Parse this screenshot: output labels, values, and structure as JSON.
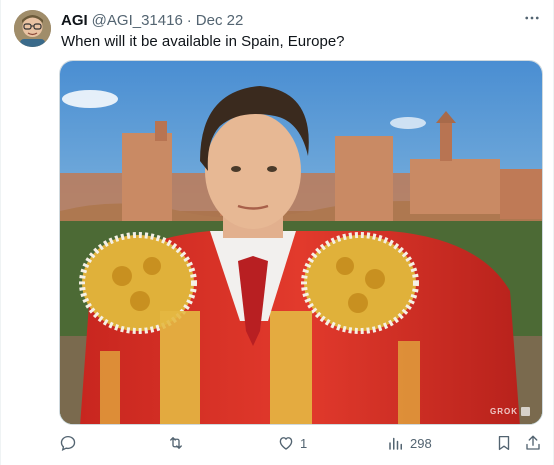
{
  "tweet": {
    "author_name": "AGI",
    "handle": "@AGI_31416",
    "separator": "·",
    "date": "Dec 22",
    "text": "When will it be available in Spain, Europe?"
  },
  "media": {
    "watermark": "GROK"
  },
  "actions": {
    "reply_count": "",
    "retweet_count": "",
    "like_count": "1",
    "views_count": "298"
  },
  "icons": {
    "reply": "reply-icon",
    "retweet": "retweet-icon",
    "like": "heart-icon",
    "views": "views-chart-icon",
    "bookmark": "bookmark-icon",
    "share": "share-icon",
    "more": "more-dots-icon"
  },
  "colors": {
    "text_primary": "#0f1419",
    "text_secondary": "#536471",
    "border": "#cfd9de"
  }
}
